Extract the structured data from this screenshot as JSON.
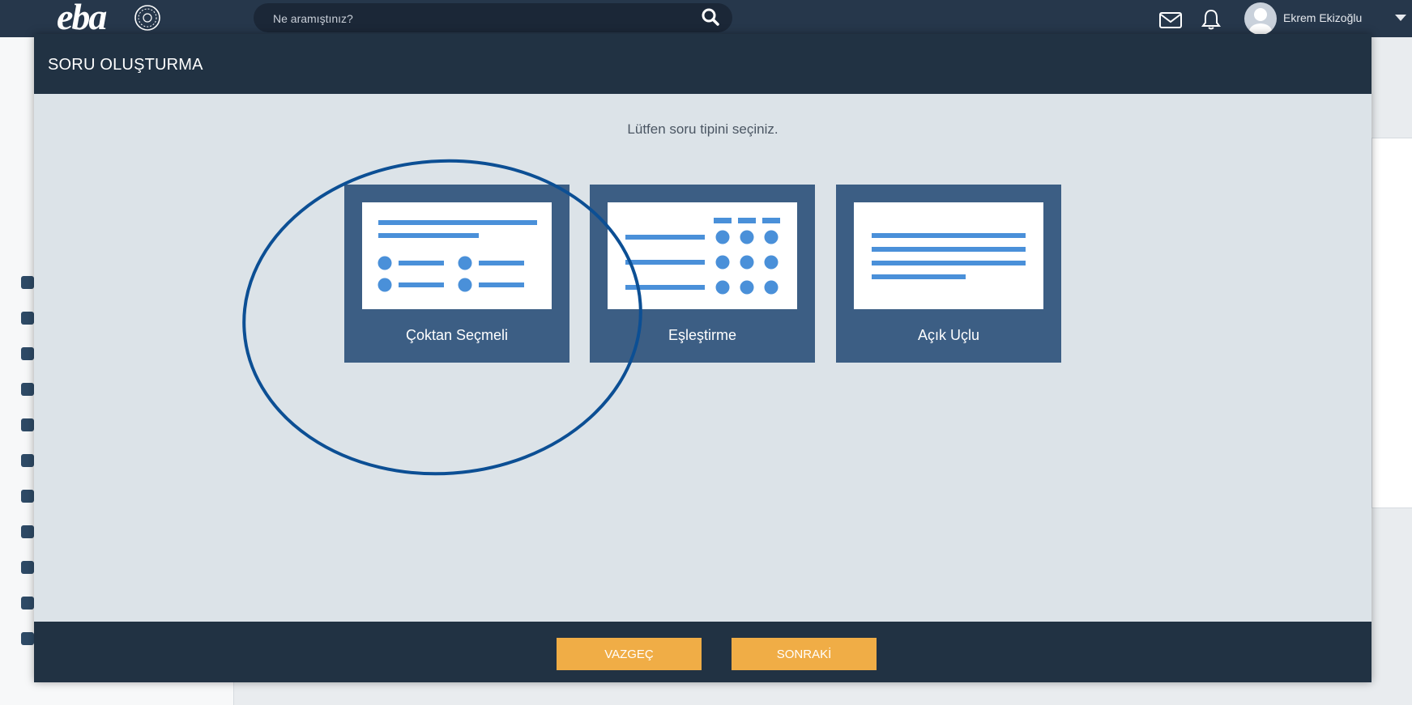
{
  "topbar": {
    "logo": "eba",
    "search_placeholder": "Ne aramıştınız?",
    "user_name": "Ekrem Ekizoğlu",
    "icons": [
      "search-icon",
      "mail-icon",
      "bell-icon",
      "avatar",
      "chevron-down-icon"
    ]
  },
  "modal": {
    "title": "SORU OLUŞTURMA",
    "instruction": "Lütfen soru tipini seçiniz.",
    "cards": [
      {
        "label": "Çoktan Seçmeli",
        "icon": "multiple-choice-icon"
      },
      {
        "label": "Eşleştirme",
        "icon": "matching-icon"
      },
      {
        "label": "Açık Uçlu",
        "icon": "open-ended-icon"
      }
    ],
    "buttons": {
      "cancel": "VAZGEÇ",
      "next": "SONRAKİ"
    }
  },
  "colors": {
    "topbar": "#26374b",
    "modal_header": "#213243",
    "modal_body": "#dce3e8",
    "card": "#3c5e84",
    "card_art_accent": "#4a90d9",
    "button": "#f0ad46",
    "selection_ring": "#0c4f94"
  }
}
